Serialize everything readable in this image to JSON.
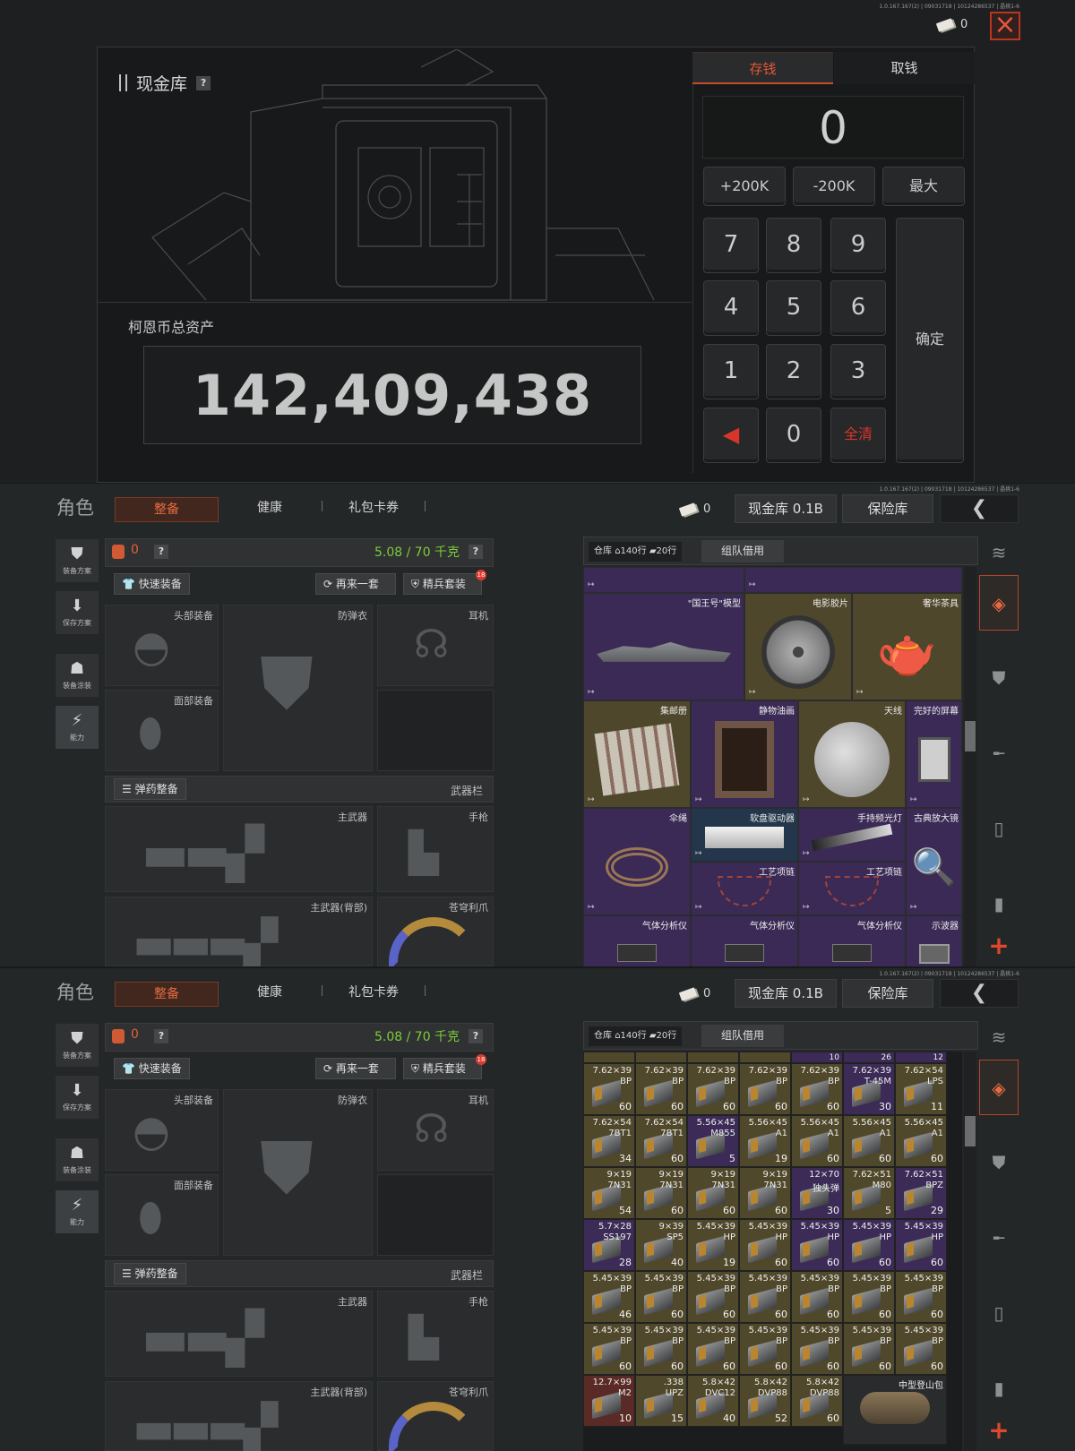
{
  "version": "1.0.167.167(2) | 09031718 | 10124286537 | 晶挑1-6",
  "vault": {
    "currency_count": "0",
    "title": "现金库",
    "help": "?",
    "tabs": [
      "存钱",
      "取钱"
    ],
    "display_value": "0",
    "presets": [
      "+200K",
      "-200K",
      "最大"
    ],
    "keys": [
      "7",
      "8",
      "9",
      "4",
      "5",
      "6",
      "1",
      "2",
      "3",
      "0"
    ],
    "confirm": "确定",
    "clear": "全清",
    "assets_label": "柯恩币总资产",
    "assets_value": "142,409,438"
  },
  "header": {
    "title": "角色",
    "tabs": [
      "整备",
      "健康",
      "礼包卡券"
    ],
    "coin_count": "0",
    "cash_vault": "现金库 0.1B",
    "insurance": "保险库"
  },
  "side": [
    "装备方案",
    "保存方案",
    "装备涂装",
    "能力"
  ],
  "loadout": {
    "bag_count": "0",
    "weight": "5.08 / 70 千克",
    "quick_equip": "快速装备",
    "again": "再来一套",
    "elite_kit": "精兵套装",
    "badge": "18",
    "slots": [
      "头部装备",
      "防弹衣",
      "耳机",
      "面部装备"
    ],
    "ammo_btn": "弹药整备",
    "weapon_bar": "武器栏",
    "weapon_slots": [
      "主武器",
      "手枪",
      "主武器(背部)",
      "苍穹利爪"
    ]
  },
  "warehouse": {
    "label": "仓库",
    "rows": "140行",
    "cols": "20行",
    "team": "组队借用",
    "items": [
      {
        "name": "\"国王号\"模型",
        "rarity": "purple"
      },
      {
        "name": "电影胶片",
        "rarity": "gold"
      },
      {
        "name": "奢华茶具",
        "rarity": "gold"
      },
      {
        "name": "集邮册",
        "rarity": "gold"
      },
      {
        "name": "静物油画",
        "rarity": "purple"
      },
      {
        "name": "天线",
        "rarity": "gold"
      },
      {
        "name": "完好的屏幕",
        "rarity": "purple"
      },
      {
        "name": "伞绳",
        "rarity": "purple"
      },
      {
        "name": "软盘驱动器",
        "rarity": "blue"
      },
      {
        "name": "手持频光灯",
        "rarity": "purple"
      },
      {
        "name": "古典放大镜",
        "rarity": "purple"
      },
      {
        "name": "工艺项链",
        "rarity": "purple"
      },
      {
        "name": "工艺项链",
        "rarity": "purple"
      },
      {
        "name": "气体分析仪",
        "rarity": "purple"
      },
      {
        "name": "气体分析仪",
        "rarity": "purple"
      },
      {
        "name": "气体分析仪",
        "rarity": "purple"
      },
      {
        "name": "示波器",
        "rarity": "purple"
      }
    ],
    "ammo_top": [
      "",
      "",
      "",
      "",
      "10",
      "26",
      "12"
    ],
    "ammo": [
      [
        [
          "7.62×39",
          "BP",
          "60",
          "gold"
        ],
        [
          "7.62×39",
          "BP",
          "60",
          "gold"
        ],
        [
          "7.62×39",
          "BP",
          "60",
          "gold"
        ],
        [
          "7.62×39",
          "BP",
          "60",
          "gold"
        ],
        [
          "7.62×39",
          "BP",
          "60",
          "gold"
        ],
        [
          "7.62×39",
          "T-45M",
          "30",
          "purple"
        ],
        [
          "7.62×54",
          "LPS",
          "11",
          "gold"
        ]
      ],
      [
        [
          "7.62×54",
          "7BT1",
          "34",
          "gold"
        ],
        [
          "7.62×54",
          "7BT1",
          "60",
          "gold"
        ],
        [
          "5.56×45",
          "M855",
          "5",
          "purple"
        ],
        [
          "5.56×45",
          "A1",
          "19",
          "gold"
        ],
        [
          "5.56×45",
          "A1",
          "60",
          "gold"
        ],
        [
          "5.56×45",
          "A1",
          "60",
          "gold"
        ],
        [
          "5.56×45",
          "A1",
          "60",
          "gold"
        ]
      ],
      [
        [
          "9×19",
          "7N31",
          "54",
          "gold"
        ],
        [
          "9×19",
          "7N31",
          "60",
          "gold"
        ],
        [
          "9×19",
          "7N31",
          "60",
          "gold"
        ],
        [
          "9×19",
          "7N31",
          "60",
          "gold"
        ],
        [
          "12×70",
          "独头弹",
          "30",
          "purple"
        ],
        [
          "7.62×51",
          "M80",
          "5",
          "gold"
        ],
        [
          "7.62×51",
          "BPZ",
          "29",
          "purple"
        ]
      ],
      [
        [
          "5.7×28",
          "SS197",
          "28",
          "purple"
        ],
        [
          "9×39",
          "SP5",
          "40",
          "gold"
        ],
        [
          "5.45×39",
          "HP",
          "19",
          "gold"
        ],
        [
          "5.45×39",
          "HP",
          "60",
          "gold"
        ],
        [
          "5.45×39",
          "HP",
          "60",
          "purple"
        ],
        [
          "5.45×39",
          "HP",
          "60",
          "purple"
        ],
        [
          "5.45×39",
          "HP",
          "60",
          "purple"
        ]
      ],
      [
        [
          "5.45×39",
          "BP",
          "46",
          "gold"
        ],
        [
          "5.45×39",
          "BP",
          "60",
          "gold"
        ],
        [
          "5.45×39",
          "BP",
          "60",
          "gold"
        ],
        [
          "5.45×39",
          "BP",
          "60",
          "gold"
        ],
        [
          "5.45×39",
          "BP",
          "60",
          "gold"
        ],
        [
          "5.45×39",
          "BP",
          "60",
          "gold"
        ],
        [
          "5.45×39",
          "BP",
          "60",
          "gold"
        ]
      ],
      [
        [
          "5.45×39",
          "BP",
          "60",
          "gold"
        ],
        [
          "5.45×39",
          "BP",
          "60",
          "gold"
        ],
        [
          "5.45×39",
          "BP",
          "60",
          "gold"
        ],
        [
          "5.45×39",
          "BP",
          "60",
          "gold"
        ],
        [
          "5.45×39",
          "BP",
          "60",
          "gold"
        ],
        [
          "5.45×39",
          "BP",
          "60",
          "gold"
        ],
        [
          "5.45×39",
          "BP",
          "60",
          "gold"
        ]
      ],
      [
        [
          "12.7×99",
          "M2",
          "10",
          "red"
        ],
        [
          ".338",
          "UPZ",
          "15",
          "gold"
        ],
        [
          "5.8×42",
          "DVC12",
          "40",
          "gold"
        ],
        [
          "5.8×42",
          "DVP88",
          "52",
          "gold"
        ],
        [
          "5.8×42",
          "DVP88",
          "60",
          "gold"
        ]
      ]
    ],
    "bag_name": "中型登山包",
    "colors": {
      "purple": "#3b2b56",
      "gold": "#50482b",
      "red": "#5a2a26",
      "blue": "#23364b",
      "accent": "#e35836"
    }
  }
}
